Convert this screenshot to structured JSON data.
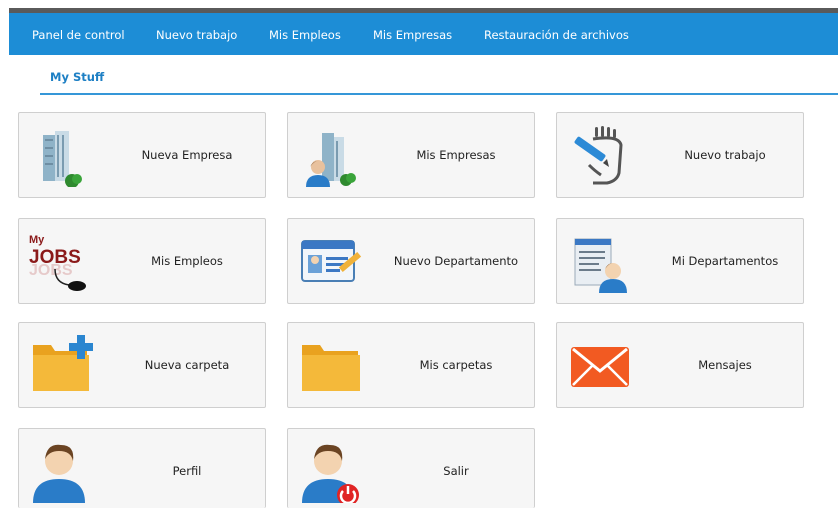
{
  "nav": {
    "items": [
      {
        "label": "Panel de control"
      },
      {
        "label": "Nuevo trabajo"
      },
      {
        "label": "Mis Empleos"
      },
      {
        "label": "Mis Empresas"
      },
      {
        "label": "Restauración de archivos"
      }
    ]
  },
  "subnav": {
    "active_tab": "My Stuff"
  },
  "tiles": [
    {
      "label": "Nueva Empresa",
      "icon": "office-building-icon"
    },
    {
      "label": "Mis Empresas",
      "icon": "building-user-icon"
    },
    {
      "label": "Nuevo trabajo",
      "icon": "hand-pen-icon"
    },
    {
      "label": "Mis Empleos",
      "icon": "my-jobs-icon",
      "icon_text": "My JOBS"
    },
    {
      "label": "Nuevo Departamento",
      "icon": "id-card-pencil-icon"
    },
    {
      "label": "Mi Departamentos",
      "icon": "document-user-icon"
    },
    {
      "label": "Nueva carpeta",
      "icon": "folder-plus-icon"
    },
    {
      "label": "Mis carpetas",
      "icon": "folder-icon"
    },
    {
      "label": "Mensajes",
      "icon": "envelope-icon"
    },
    {
      "label": "Perfil",
      "icon": "user-icon"
    },
    {
      "label": "Salir",
      "icon": "user-logout-icon"
    }
  ],
  "colors": {
    "navbar": "#1d8dd6",
    "topstrip": "#5a5a5a",
    "tab_text": "#1d7fc4",
    "underline": "#3597d8"
  }
}
